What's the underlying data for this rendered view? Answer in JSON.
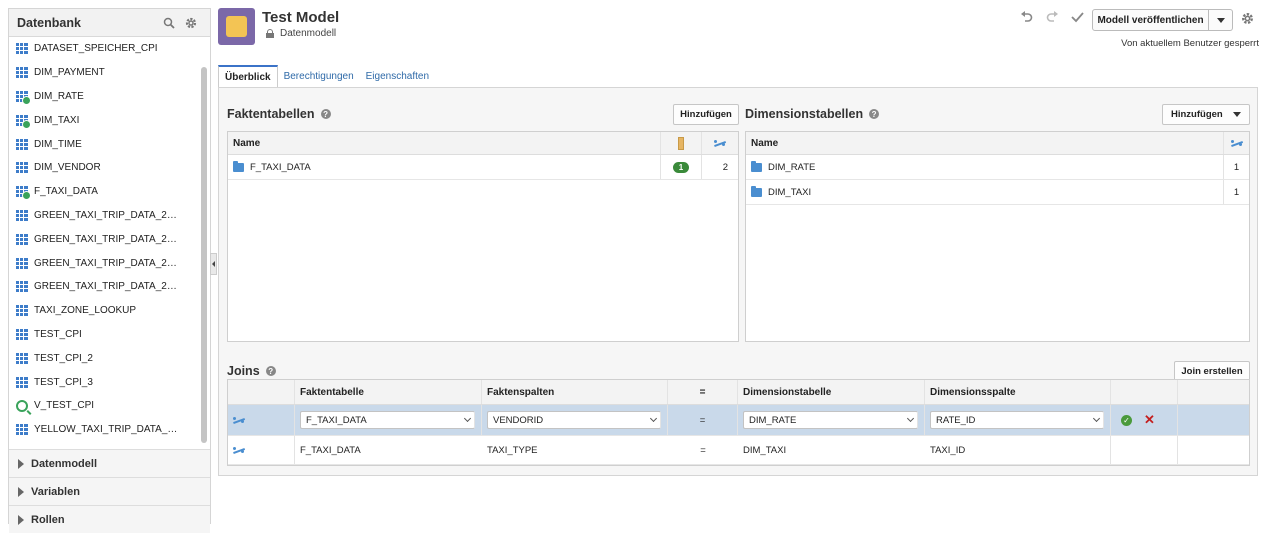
{
  "sidebar": {
    "title": "Datenbank",
    "items": [
      {
        "label": "DATASET_SPEICHER_CPI",
        "icon": "table-icon"
      },
      {
        "label": "DIM_PAYMENT",
        "icon": "table-icon"
      },
      {
        "label": "DIM_RATE",
        "icon": "table-used-icon"
      },
      {
        "label": "DIM_TAXI",
        "icon": "table-used-icon"
      },
      {
        "label": "DIM_TIME",
        "icon": "table-icon"
      },
      {
        "label": "DIM_VENDOR",
        "icon": "table-icon"
      },
      {
        "label": "F_TAXI_DATA",
        "icon": "table-used-icon"
      },
      {
        "label": "GREEN_TAXI_TRIP_DATA_2…",
        "icon": "table-icon"
      },
      {
        "label": "GREEN_TAXI_TRIP_DATA_2…",
        "icon": "table-icon"
      },
      {
        "label": "GREEN_TAXI_TRIP_DATA_2…",
        "icon": "table-icon"
      },
      {
        "label": "GREEN_TAXI_TRIP_DATA_2…",
        "icon": "table-icon"
      },
      {
        "label": "TAXI_ZONE_LOOKUP",
        "icon": "table-icon"
      },
      {
        "label": "TEST_CPI",
        "icon": "table-icon"
      },
      {
        "label": "TEST_CPI_2",
        "icon": "table-icon"
      },
      {
        "label": "TEST_CPI_3",
        "icon": "table-icon"
      },
      {
        "label": "V_TEST_CPI",
        "icon": "view-icon"
      },
      {
        "label": "YELLOW_TAXI_TRIP_DATA_…",
        "icon": "table-icon"
      }
    ],
    "sections": [
      "Datenmodell",
      "Variablen",
      "Rollen"
    ]
  },
  "header": {
    "title": "Test Model",
    "subtitle": "Datenmodell",
    "publish_label": "Modell veröffentlichen",
    "locked_text": "Von aktuellem Benutzer gesperrt"
  },
  "tabs": [
    "Überblick",
    "Berechtigungen",
    "Eigenschaften"
  ],
  "fact_tables": {
    "title": "Faktentabellen",
    "add_label": "Hinzufügen",
    "col_name": "Name",
    "rows": [
      {
        "name": "F_TAXI_DATA",
        "columns_badge": "1",
        "joins": "2"
      }
    ]
  },
  "dim_tables": {
    "title": "Dimensionstabellen",
    "add_label": "Hinzufügen",
    "col_name": "Name",
    "rows": [
      {
        "name": "DIM_RATE",
        "joins": "1"
      },
      {
        "name": "DIM_TAXI",
        "joins": "1"
      }
    ]
  },
  "joins": {
    "title": "Joins",
    "create_label": "Join erstellen",
    "headers": [
      "Faktentabelle",
      "Faktenspalten",
      "=",
      "Dimensionstabelle",
      "Dimensionsspalte"
    ],
    "edit_row": {
      "fact_table": "F_TAXI_DATA",
      "fact_column": "VENDORID",
      "op": "=",
      "dim_table": "DIM_RATE",
      "dim_column": "RATE_ID"
    },
    "rows": [
      {
        "fact_table": "F_TAXI_DATA",
        "fact_column": "TAXI_TYPE",
        "op": "=",
        "dim_table": "DIM_TAXI",
        "dim_column": "TAXI_ID"
      }
    ]
  }
}
